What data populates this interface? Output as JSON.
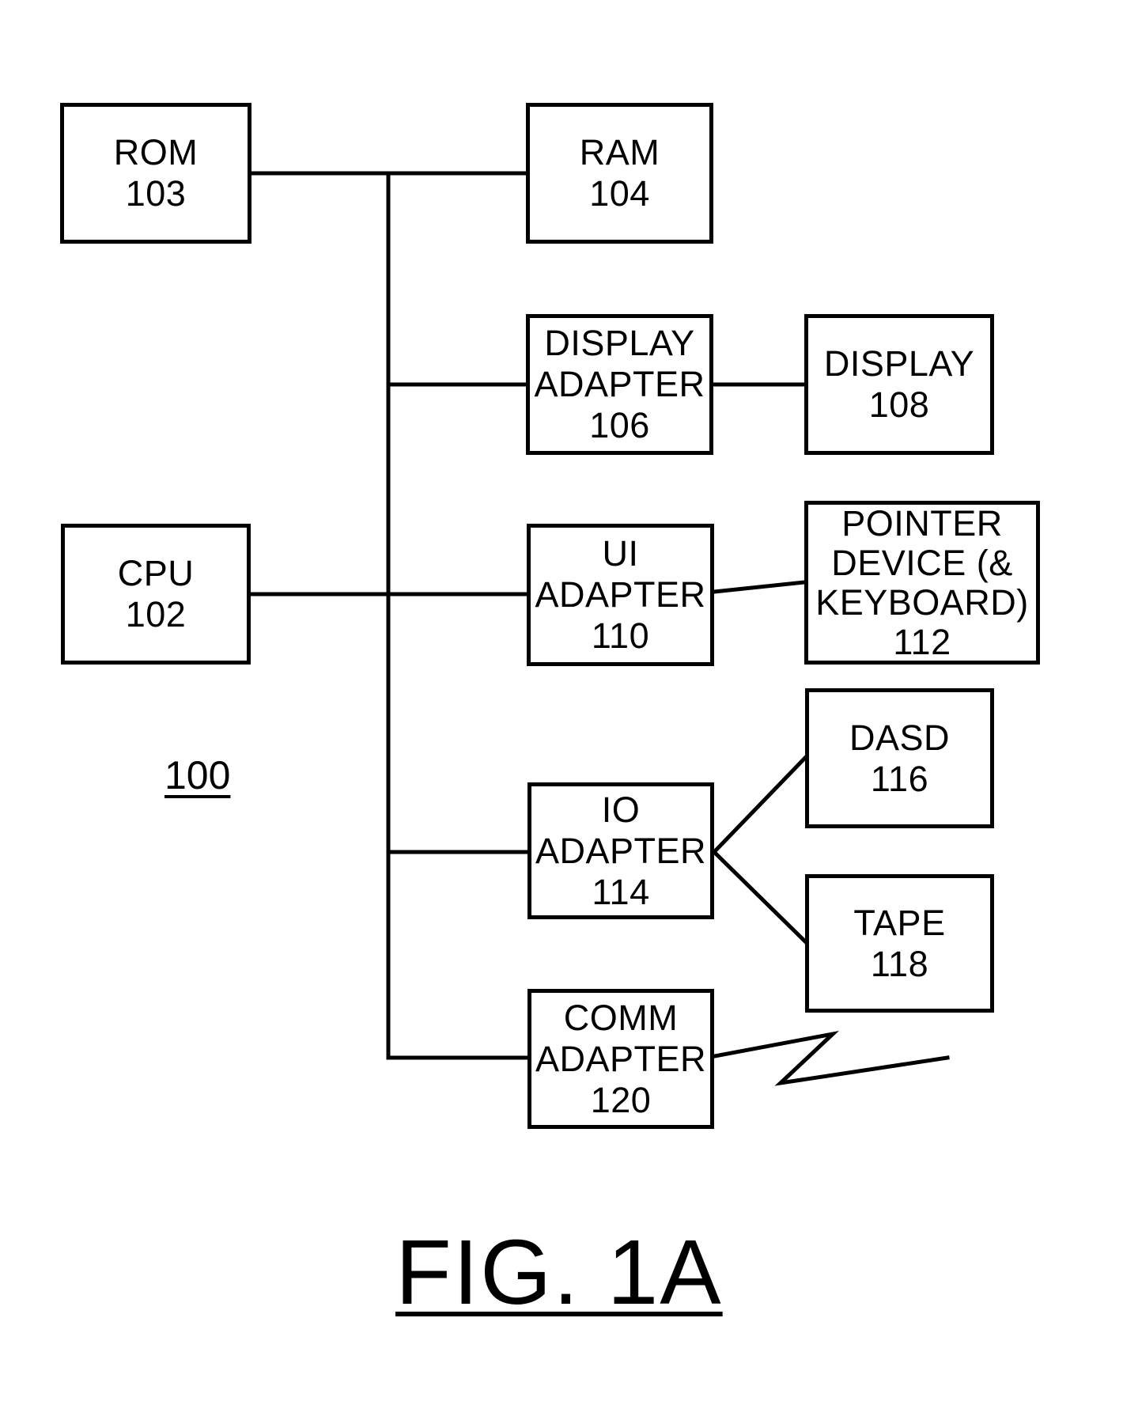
{
  "figure": {
    "title": "FIG. 1A",
    "reference_label": "100"
  },
  "components": {
    "rom": {
      "lines": [
        "ROM",
        "103"
      ]
    },
    "ram": {
      "lines": [
        "RAM",
        "104"
      ]
    },
    "cpu": {
      "lines": [
        "CPU",
        "102"
      ]
    },
    "display_adapter": {
      "lines": [
        "DISPLAY",
        "ADAPTER",
        "106"
      ]
    },
    "display": {
      "lines": [
        "DISPLAY",
        "108"
      ]
    },
    "ui_adapter": {
      "lines": [
        "UI",
        "ADAPTER",
        "110"
      ]
    },
    "pointer_device": {
      "lines": [
        "POINTER",
        "DEVICE (&",
        "KEYBOARD)",
        "112"
      ]
    },
    "io_adapter": {
      "lines": [
        "IO",
        "ADAPTER",
        "114"
      ]
    },
    "dasd": {
      "lines": [
        "DASD",
        "116"
      ]
    },
    "tape": {
      "lines": [
        "TAPE",
        "118"
      ]
    },
    "comm_adapter": {
      "lines": [
        "COMM",
        "ADAPTER",
        "120"
      ]
    }
  },
  "connections": [
    [
      "rom",
      "bus"
    ],
    [
      "ram",
      "bus"
    ],
    [
      "cpu",
      "bus"
    ],
    [
      "display_adapter",
      "bus"
    ],
    [
      "ui_adapter",
      "bus"
    ],
    [
      "io_adapter",
      "bus"
    ],
    [
      "comm_adapter",
      "bus"
    ],
    [
      "display_adapter",
      "display"
    ],
    [
      "ui_adapter",
      "pointer_device"
    ],
    [
      "io_adapter",
      "dasd"
    ],
    [
      "io_adapter",
      "tape"
    ],
    [
      "comm_adapter",
      "network-link"
    ]
  ]
}
